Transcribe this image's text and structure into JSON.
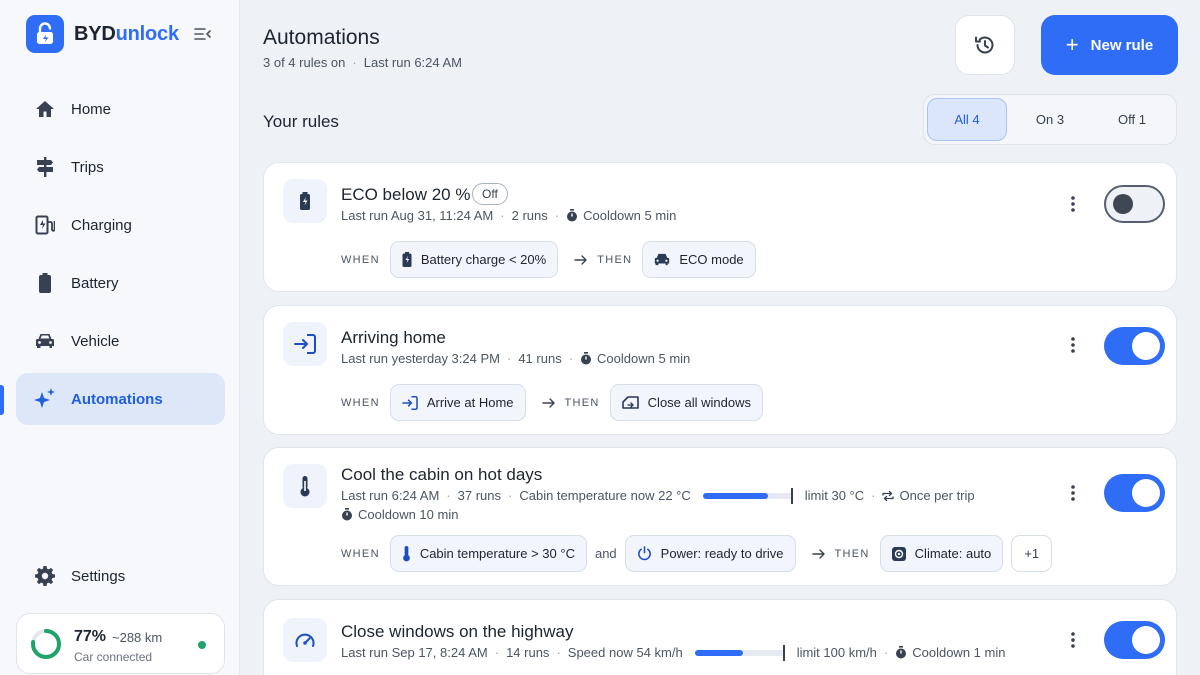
{
  "brand": {
    "name_prefix": "BYD",
    "name_accent": "unlock"
  },
  "nav": {
    "items": [
      {
        "label": "Home",
        "icon": "home-icon"
      },
      {
        "label": "Trips",
        "icon": "signpost-icon"
      },
      {
        "label": "Charging",
        "icon": "charging-station-icon"
      },
      {
        "label": "Battery",
        "icon": "battery-icon"
      },
      {
        "label": "Vehicle",
        "icon": "car-icon"
      },
      {
        "label": "Automations",
        "icon": "sparkle-icon",
        "active": true
      }
    ],
    "settings_label": "Settings"
  },
  "status": {
    "percent": "77%",
    "range": "~288 km",
    "connection": "Car connected",
    "battery_level": 0.77
  },
  "header": {
    "title": "Automations",
    "rules_on": "3 of 4 rules on",
    "last_run": "Last run 6:24 AM",
    "new_rule_label": "New rule",
    "plus": "+"
  },
  "section": {
    "title": "Your rules"
  },
  "filters": [
    {
      "label": "All 4",
      "selected": true
    },
    {
      "label": "On 3"
    },
    {
      "label": "Off 1"
    }
  ],
  "keywords": {
    "when": "WHEN",
    "then": "THEN",
    "and": "and"
  },
  "rules": [
    {
      "title": "ECO below 20 %",
      "badge": "Off",
      "last_run": "Last run Aug 31, 11:24 AM",
      "runs": "2 runs",
      "cooldown": "Cooldown 5 min",
      "when": "Battery charge < 20%",
      "then": "ECO mode",
      "enabled": false
    },
    {
      "title": "Arriving home",
      "last_run": "Last run yesterday 3:24 PM",
      "runs": "41 runs",
      "cooldown": "Cooldown 5 min",
      "when": "Arrive at Home",
      "then": "Close all windows",
      "enabled": true
    },
    {
      "title": "Cool the cabin on hot days",
      "last_run": "Last run 6:24 AM",
      "runs": "37 runs",
      "current": "Cabin temperature now 22 °C",
      "limit": "limit 30 °C",
      "frequency": "Once per trip",
      "cooldown": "Cooldown 10 min",
      "when": "Cabin temperature > 30 °C",
      "when2": "Power: ready to drive",
      "then": "Climate: auto",
      "more": "+1",
      "meter_fill": 0.73,
      "meter_limit": 1.0,
      "enabled": true
    },
    {
      "title": "Close windows on the highway",
      "last_run": "Last run Sep 17, 8:24 AM",
      "runs": "14 runs",
      "current": "Speed now 54 km/h",
      "limit": "limit 100 km/h",
      "cooldown": "Cooldown 1 min",
      "meter_fill": 0.54,
      "meter_limit": 1.0,
      "enabled": true
    }
  ]
}
